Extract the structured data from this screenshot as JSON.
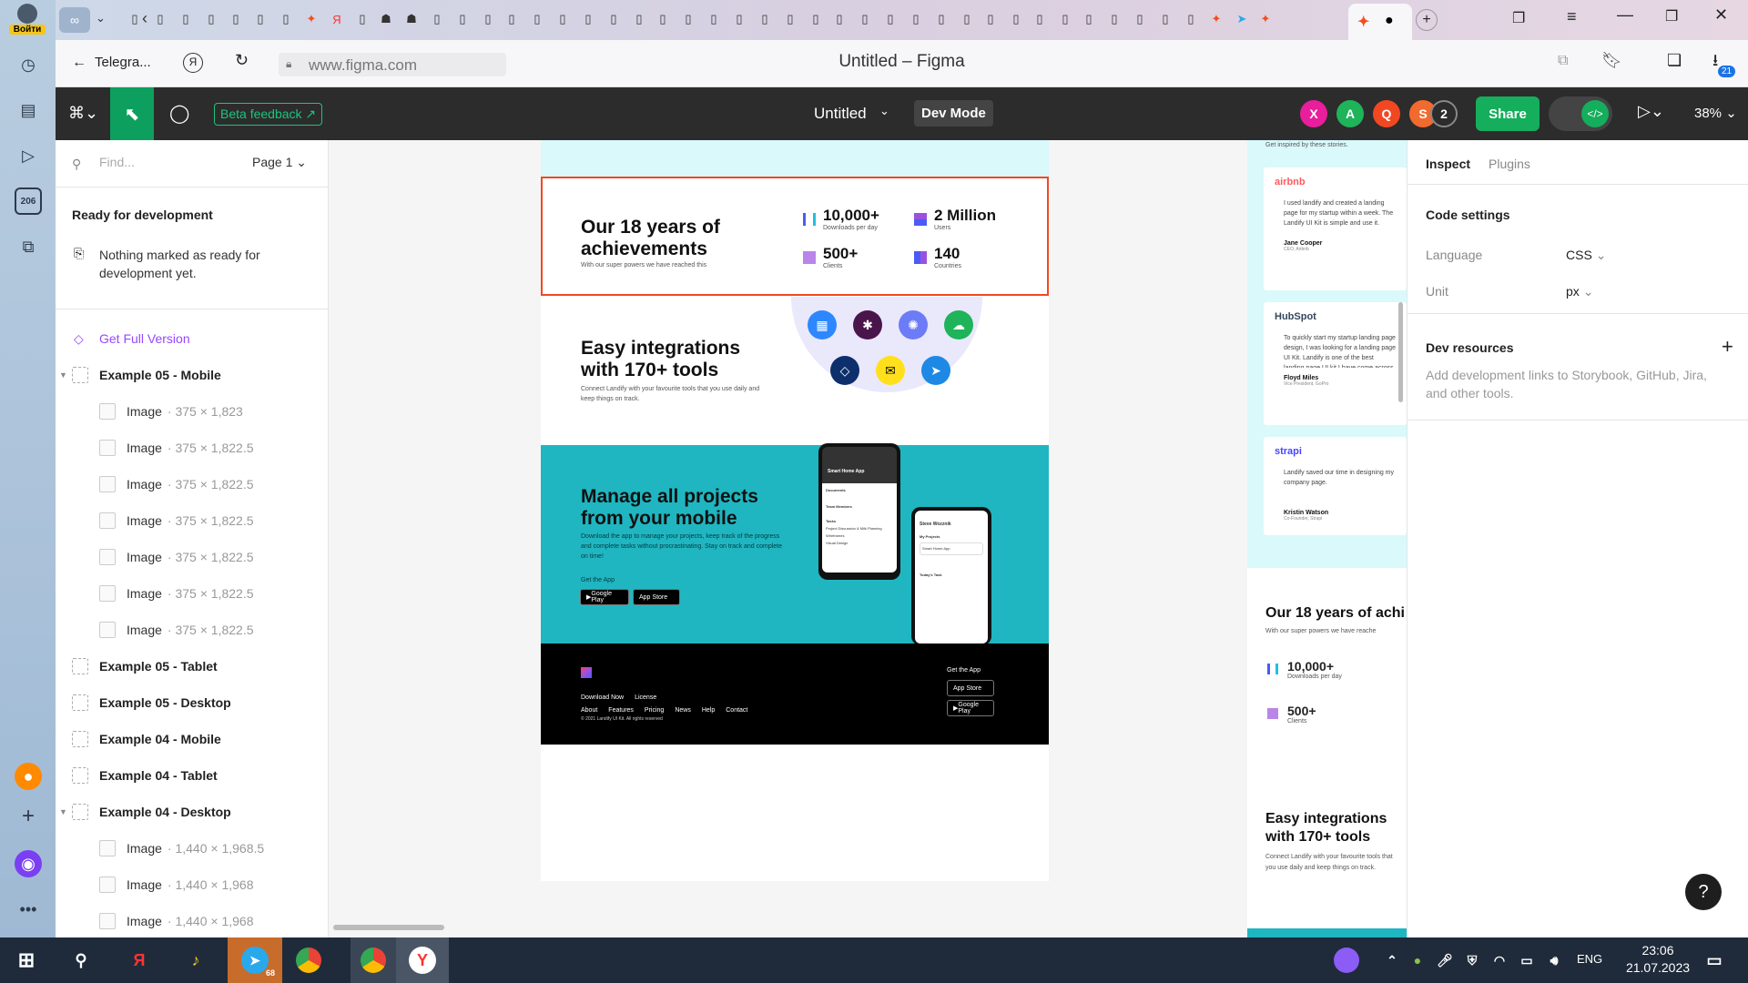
{
  "browser": {
    "login_label": "Войти",
    "sidebar_badge": "206",
    "back_page": "Telegra...",
    "url": "www.figma.com",
    "page_title": "Untitled – Figma",
    "downloads_count": "21"
  },
  "figma": {
    "beta_label": "Beta feedback",
    "file_name": "Untitled",
    "dev_mode_label": "Dev Mode",
    "avatars": [
      {
        "letter": "X",
        "color": "#e91e9c"
      },
      {
        "letter": "A",
        "color": "#1fb35a"
      },
      {
        "letter": "Q",
        "color": "#f24822"
      },
      {
        "letter": "S",
        "color": "#f26a2e"
      }
    ],
    "extra_users": "2",
    "share_label": "Share",
    "zoom": "38%"
  },
  "left_panel": {
    "find_placeholder": "Find...",
    "page_select": "Page 1",
    "ready_title": "Ready for development",
    "ready_empty": "Nothing marked as ready for development yet.",
    "get_full": "Get Full Version",
    "layers": [
      {
        "name": "Example 05 - Mobile",
        "size": "",
        "type": "frame",
        "expanded": true
      },
      {
        "name": "Image",
        "size": "· 375 × 1,823",
        "type": "image"
      },
      {
        "name": "Image",
        "size": "· 375 × 1,822.5",
        "type": "image"
      },
      {
        "name": "Image",
        "size": "· 375 × 1,822.5",
        "type": "image"
      },
      {
        "name": "Image",
        "size": "· 375 × 1,822.5",
        "type": "image"
      },
      {
        "name": "Image",
        "size": "· 375 × 1,822.5",
        "type": "image"
      },
      {
        "name": "Image",
        "size": "· 375 × 1,822.5",
        "type": "image"
      },
      {
        "name": "Image",
        "size": "· 375 × 1,822.5",
        "type": "image"
      },
      {
        "name": "Example 05 - Tablet",
        "size": "",
        "type": "frame"
      },
      {
        "name": "Example 05 - Desktop",
        "size": "",
        "type": "frame"
      },
      {
        "name": "Example 04 - Mobile",
        "size": "",
        "type": "frame"
      },
      {
        "name": "Example 04 - Tablet",
        "size": "",
        "type": "frame"
      },
      {
        "name": "Example 04 - Desktop",
        "size": "",
        "type": "frame",
        "expanded": true
      },
      {
        "name": "Image",
        "size": "· 1,440 × 1,968.5",
        "type": "image"
      },
      {
        "name": "Image",
        "size": "· 1,440 × 1,968",
        "type": "image"
      },
      {
        "name": "Image",
        "size": "· 1,440 × 1,968",
        "type": "image"
      }
    ]
  },
  "canvas": {
    "achievements": {
      "title": "Our 18 years of achievements",
      "subtitle": "With our super powers we have reached this",
      "stats": [
        {
          "num": "10,000+",
          "label": "Downloads per day"
        },
        {
          "num": "2 Million",
          "label": "Users"
        },
        {
          "num": "500+",
          "label": "Clients"
        },
        {
          "num": "140",
          "label": "Countries"
        }
      ]
    },
    "integrations": {
      "title": "Easy integrations with 170+ tools",
      "subtitle": "Connect Landify with your favourite tools that you use daily and keep things on track."
    },
    "mobile": {
      "title": "Manage all projects from your mobile",
      "subtitle": "Download the app to manage your projects, keep track of the progress and complete tasks without procrastinating. Stay on track and complete on time!",
      "get_app": "Get the App",
      "google_play": "Google Play",
      "app_store": "App Store",
      "phone1_title": "Smart Home App",
      "phone2_title": "Steve Wozznik",
      "documents_label": "Documents",
      "team_label": "Team Members",
      "tasks_label": "Tasks",
      "task1": "Project Discussion & Milk Planning",
      "task2": "Wireframes",
      "task3": "Visual Design",
      "my_projects": "My Projects",
      "project_name": "Smart Home App",
      "todays_task": "Today's Task"
    },
    "footer": {
      "links_row1": [
        "Download Now",
        "License"
      ],
      "links_row2": [
        "About",
        "Features",
        "Pricing",
        "News",
        "Help",
        "Contact"
      ],
      "copyright": "© 2021 Landify UI Kit. All rights reserved",
      "get_app": "Get the App",
      "app_store": "App Store",
      "google_play": "Google Play"
    },
    "side_frame": {
      "inspired": "Get inspired by these stories.",
      "testimonials": [
        {
          "brand": "airbnb",
          "brand_color": "#ff5a5f",
          "quote": "I used landify and created a landing page for my startup within a week. The Landify UI Kit is simple and use it.",
          "name": "Jane Cooper",
          "role": "CEO, Airbnb"
        },
        {
          "brand": "HubSpot",
          "brand_color": "#33475b",
          "quote": "To quickly start my startup landing page design, I was looking for a landing page UI Kit. Landify is one of the best landing page UI kit I have come across. It's so flexible",
          "name": "Floyd Miles",
          "role": "Vice President, GoPro"
        },
        {
          "brand": "strapi",
          "brand_color": "#4945ff",
          "quote": "Landify saved our time in designing my company page.",
          "name": "Kristin Watson",
          "role": "Co-Founder, Strapi"
        }
      ],
      "ach_title": "Our 18 years of achi",
      "ach_sub": "With our super powers we have reache",
      "stat1_num": "10,000+",
      "stat1_lbl": "Downloads per day",
      "stat2_num": "500+",
      "stat2_lbl": "Clients",
      "int_title": "Easy integrations with 170+ tools",
      "int_sub": "Connect Landify with your favourite tools that you use daily and keep things on track."
    }
  },
  "right_panel": {
    "tab_inspect": "Inspect",
    "tab_plugins": "Plugins",
    "code_settings": "Code settings",
    "language_label": "Language",
    "language_value": "CSS",
    "unit_label": "Unit",
    "unit_value": "px",
    "dev_resources": "Dev resources",
    "dev_resources_desc": "Add development links to Storybook, GitHub, Jira, and other tools."
  },
  "taskbar": {
    "lang": "ENG",
    "time": "23:06",
    "date": "21.07.2023",
    "telegram_badge": "68"
  }
}
